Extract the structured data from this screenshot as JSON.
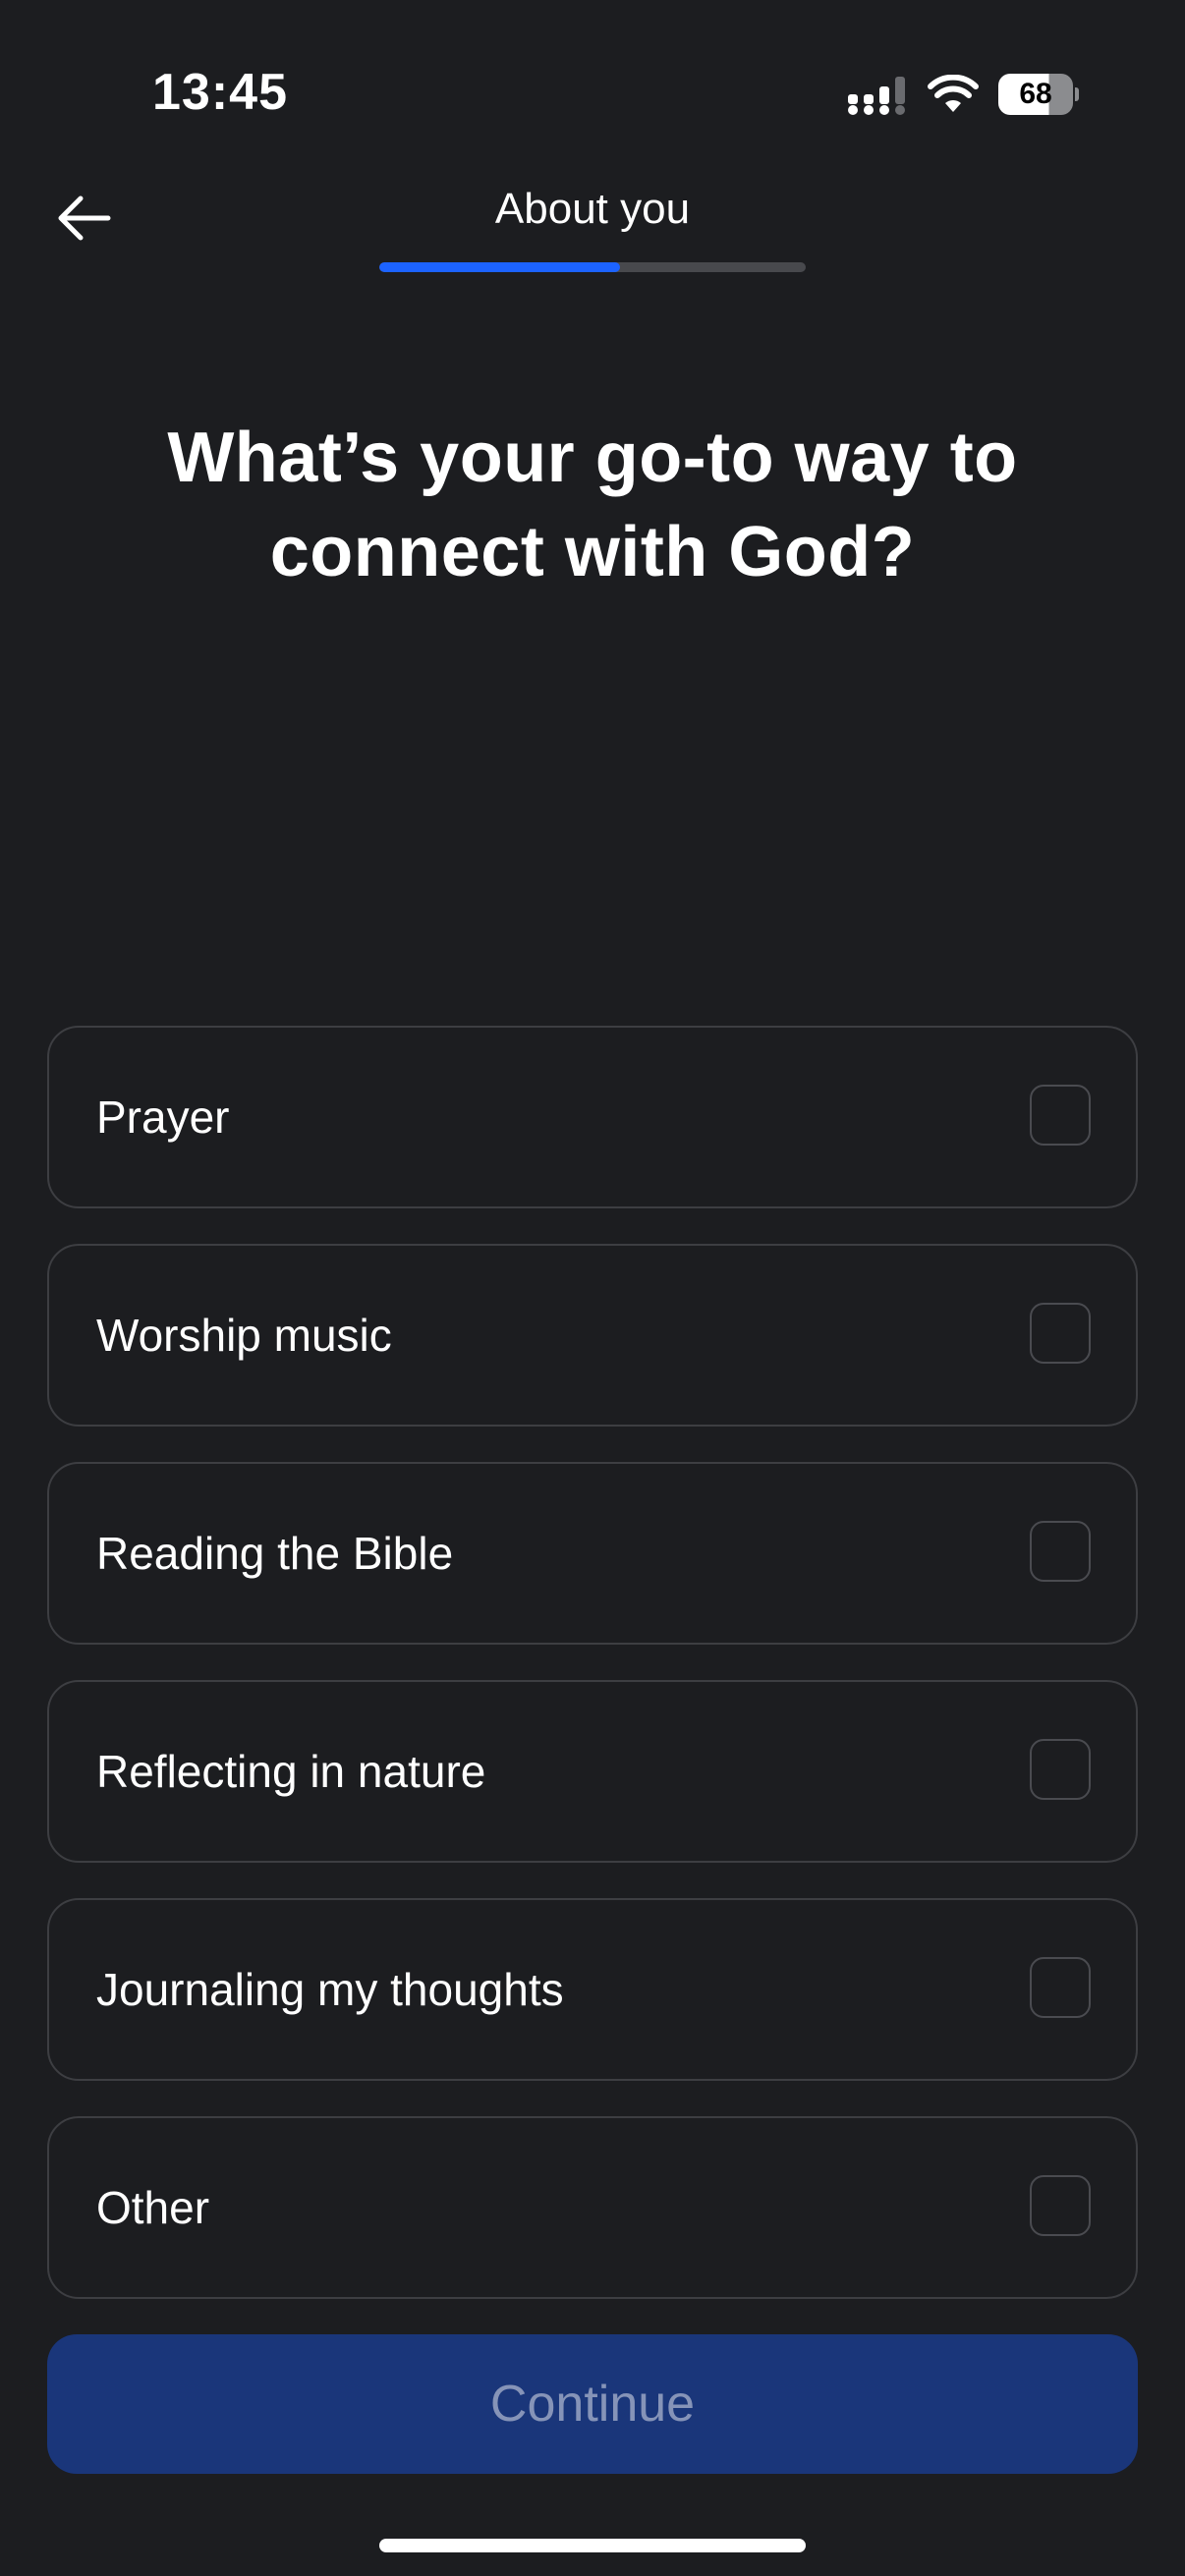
{
  "status_bar": {
    "time": "13:45",
    "battery_level": "68",
    "icons": [
      "signal-icon",
      "wifi-icon",
      "battery-icon"
    ]
  },
  "header": {
    "back_icon": "arrow-left-icon",
    "title": "About you",
    "progress_fraction": 0.565,
    "progress_color": "#1c63ff"
  },
  "question": {
    "title": "What’s your go-to way to connect with God?"
  },
  "options": [
    {
      "label": "Prayer",
      "checked": false
    },
    {
      "label": "Worship music",
      "checked": false
    },
    {
      "label": "Reading the Bible",
      "checked": false
    },
    {
      "label": "Reflecting in nature",
      "checked": false
    },
    {
      "label": "Journaling my thoughts",
      "checked": false
    },
    {
      "label": "Other",
      "checked": false
    }
  ],
  "continue_button": {
    "label": "Continue",
    "enabled": false,
    "background": "#1a367a"
  }
}
